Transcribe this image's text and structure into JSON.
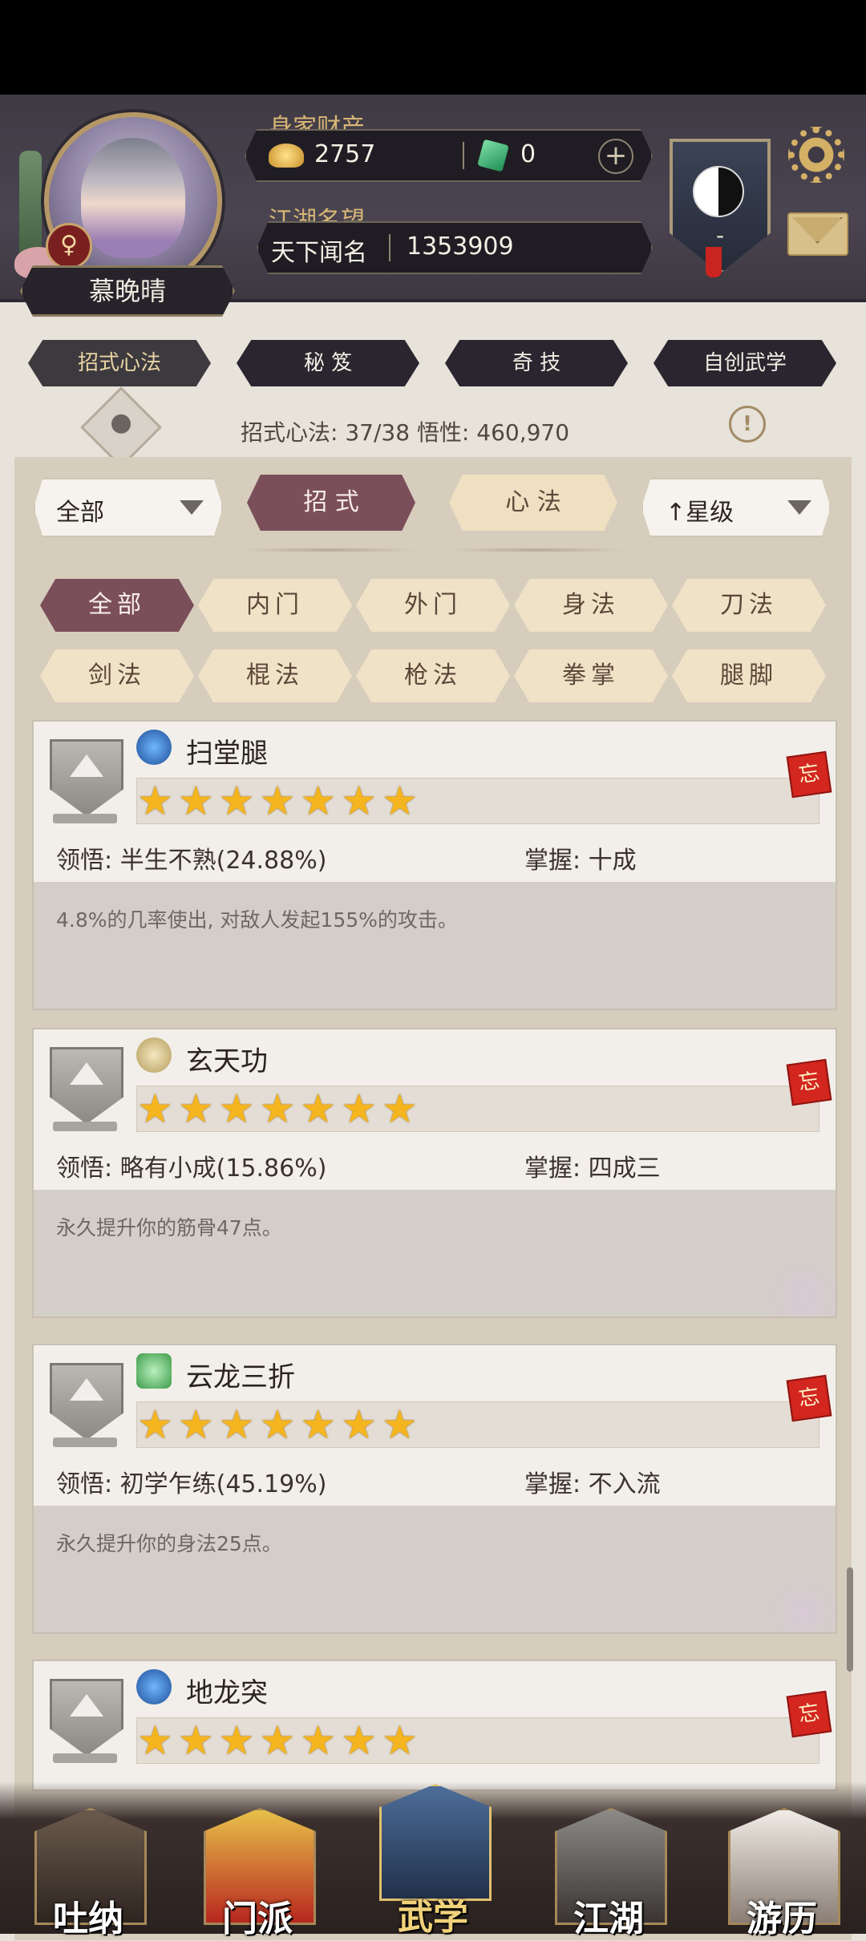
{
  "character": {
    "name": "慕晚晴",
    "gender_symbol": "♀"
  },
  "wealth": {
    "label": "身家财产",
    "silver": "2757",
    "jade": "0"
  },
  "reputation": {
    "label": "江湖名望",
    "title": "天下闻名",
    "value": "1353909"
  },
  "sect": {
    "rank": "-"
  },
  "main_tabs": [
    "招式心法",
    "秘 笈",
    "奇 技",
    "自创武学"
  ],
  "stats": {
    "text": "招式心法: 37/38  悟性: 460,970"
  },
  "filters": {
    "left_dropdown": "全部",
    "type_tab_active": "招 式",
    "type_tab_other": "心 法",
    "sort_dropdown": "↑星级"
  },
  "categories_row1": [
    "全部",
    "内门",
    "外门",
    "身法",
    "刀法"
  ],
  "categories_row2": [
    "剑法",
    "棍法",
    "枪法",
    "拳掌",
    "腿脚"
  ],
  "skills": [
    {
      "name": "扫堂腿",
      "stars": "★★★★★★★",
      "star_count": 7,
      "comprehension": "领悟: 半生不熟(24.88%)",
      "mastery": "掌握: 十成",
      "description": "4.8%的几率使出, 对敌人发起155%的攻击。",
      "forget_label": "忘",
      "type_icon": "leg-style-icon"
    },
    {
      "name": "玄天功",
      "stars": "★★★★★★★",
      "star_count": 7,
      "comprehension": "领悟: 略有小成(15.86%)",
      "mastery": "掌握: 四成三",
      "description": "永久提升你的筋骨47点。",
      "forget_label": "忘",
      "type_icon": "inner-art-icon"
    },
    {
      "name": "云龙三折",
      "stars": "★★★★★★★",
      "star_count": 7,
      "comprehension": "领悟: 初学乍练(45.19%)",
      "mastery": "掌握: 不入流",
      "description": "永久提升你的身法25点。",
      "forget_label": "忘",
      "type_icon": "movement-icon"
    },
    {
      "name": "地龙突",
      "stars": "★★★★★★★",
      "star_count": 7,
      "forget_label": "忘",
      "type_icon": "leg-style-icon"
    }
  ],
  "bottom_nav": [
    {
      "label": "吐纳",
      "active": false
    },
    {
      "label": "门派",
      "active": false
    },
    {
      "label": "武学",
      "active": true
    },
    {
      "label": "江湖",
      "active": false
    },
    {
      "label": "游历",
      "active": false
    }
  ],
  "colors": {
    "accent_active": "#7b4f5a",
    "tab_inactive": "#f0e2c6",
    "star": "#f5b51e",
    "header_bg": "#443f48"
  }
}
